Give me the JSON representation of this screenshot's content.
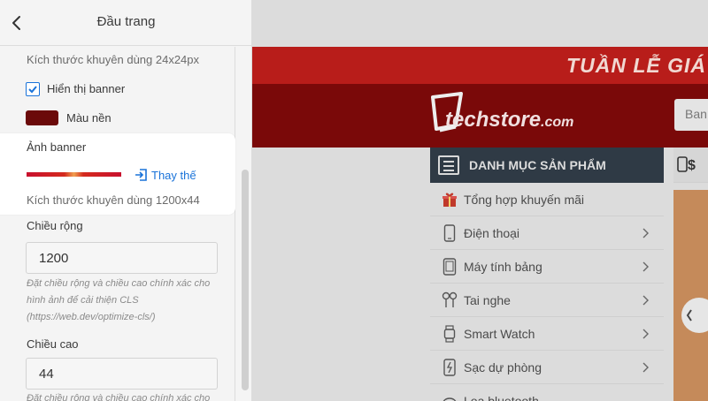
{
  "panel": {
    "title": "Đầu trang",
    "recommend_icon_size": "Kích thước khuyên dùng 24x24px",
    "show_banner_label": "Hiển thị banner",
    "background_label": "Màu nền",
    "background_color": "#6b0a0a",
    "banner_image_label": "Ảnh banner",
    "replace_label": "Thay thế",
    "recommend_banner_size": "Kích thước khuyên dùng 1200x44",
    "width_label": "Chiều rộng",
    "width_value": "1200",
    "help_text": "Đặt chiều rộng và chiều cao chính xác cho hình ảnh để cải thiện CLS (https://web.dev/optimize-cls/)",
    "height_label": "Chiều cao",
    "height_value": "44",
    "help_text_2": "Đặt chiều rộng và chiều cao chính xác cho"
  },
  "preview": {
    "promo_text": "TUẦN LỄ GIÁ",
    "logo_main": "techstore",
    "logo_suffix": ".com",
    "search_placeholder": "Ban",
    "category_title": "DANH MỤC SẢN PHẨM",
    "side_box_text": "$",
    "categories": [
      {
        "label": "Tổng hợp khuyến mãi",
        "icon": "gift-icon"
      },
      {
        "label": "Điện thoại",
        "icon": "phone-icon"
      },
      {
        "label": "Máy tính bảng",
        "icon": "tablet-icon"
      },
      {
        "label": "Tai nghe",
        "icon": "earphone-icon"
      },
      {
        "label": "Smart Watch",
        "icon": "watch-icon"
      },
      {
        "label": "Sạc dự phòng",
        "icon": "powerbank-icon"
      },
      {
        "label": "Loa bluetooth",
        "icon": "speaker-icon"
      }
    ]
  },
  "colors": {
    "accent": "#1a73d9",
    "brand_red": "#b81d1a",
    "header_dark_red": "#7a0909",
    "menu_head": "#2f3a45"
  }
}
